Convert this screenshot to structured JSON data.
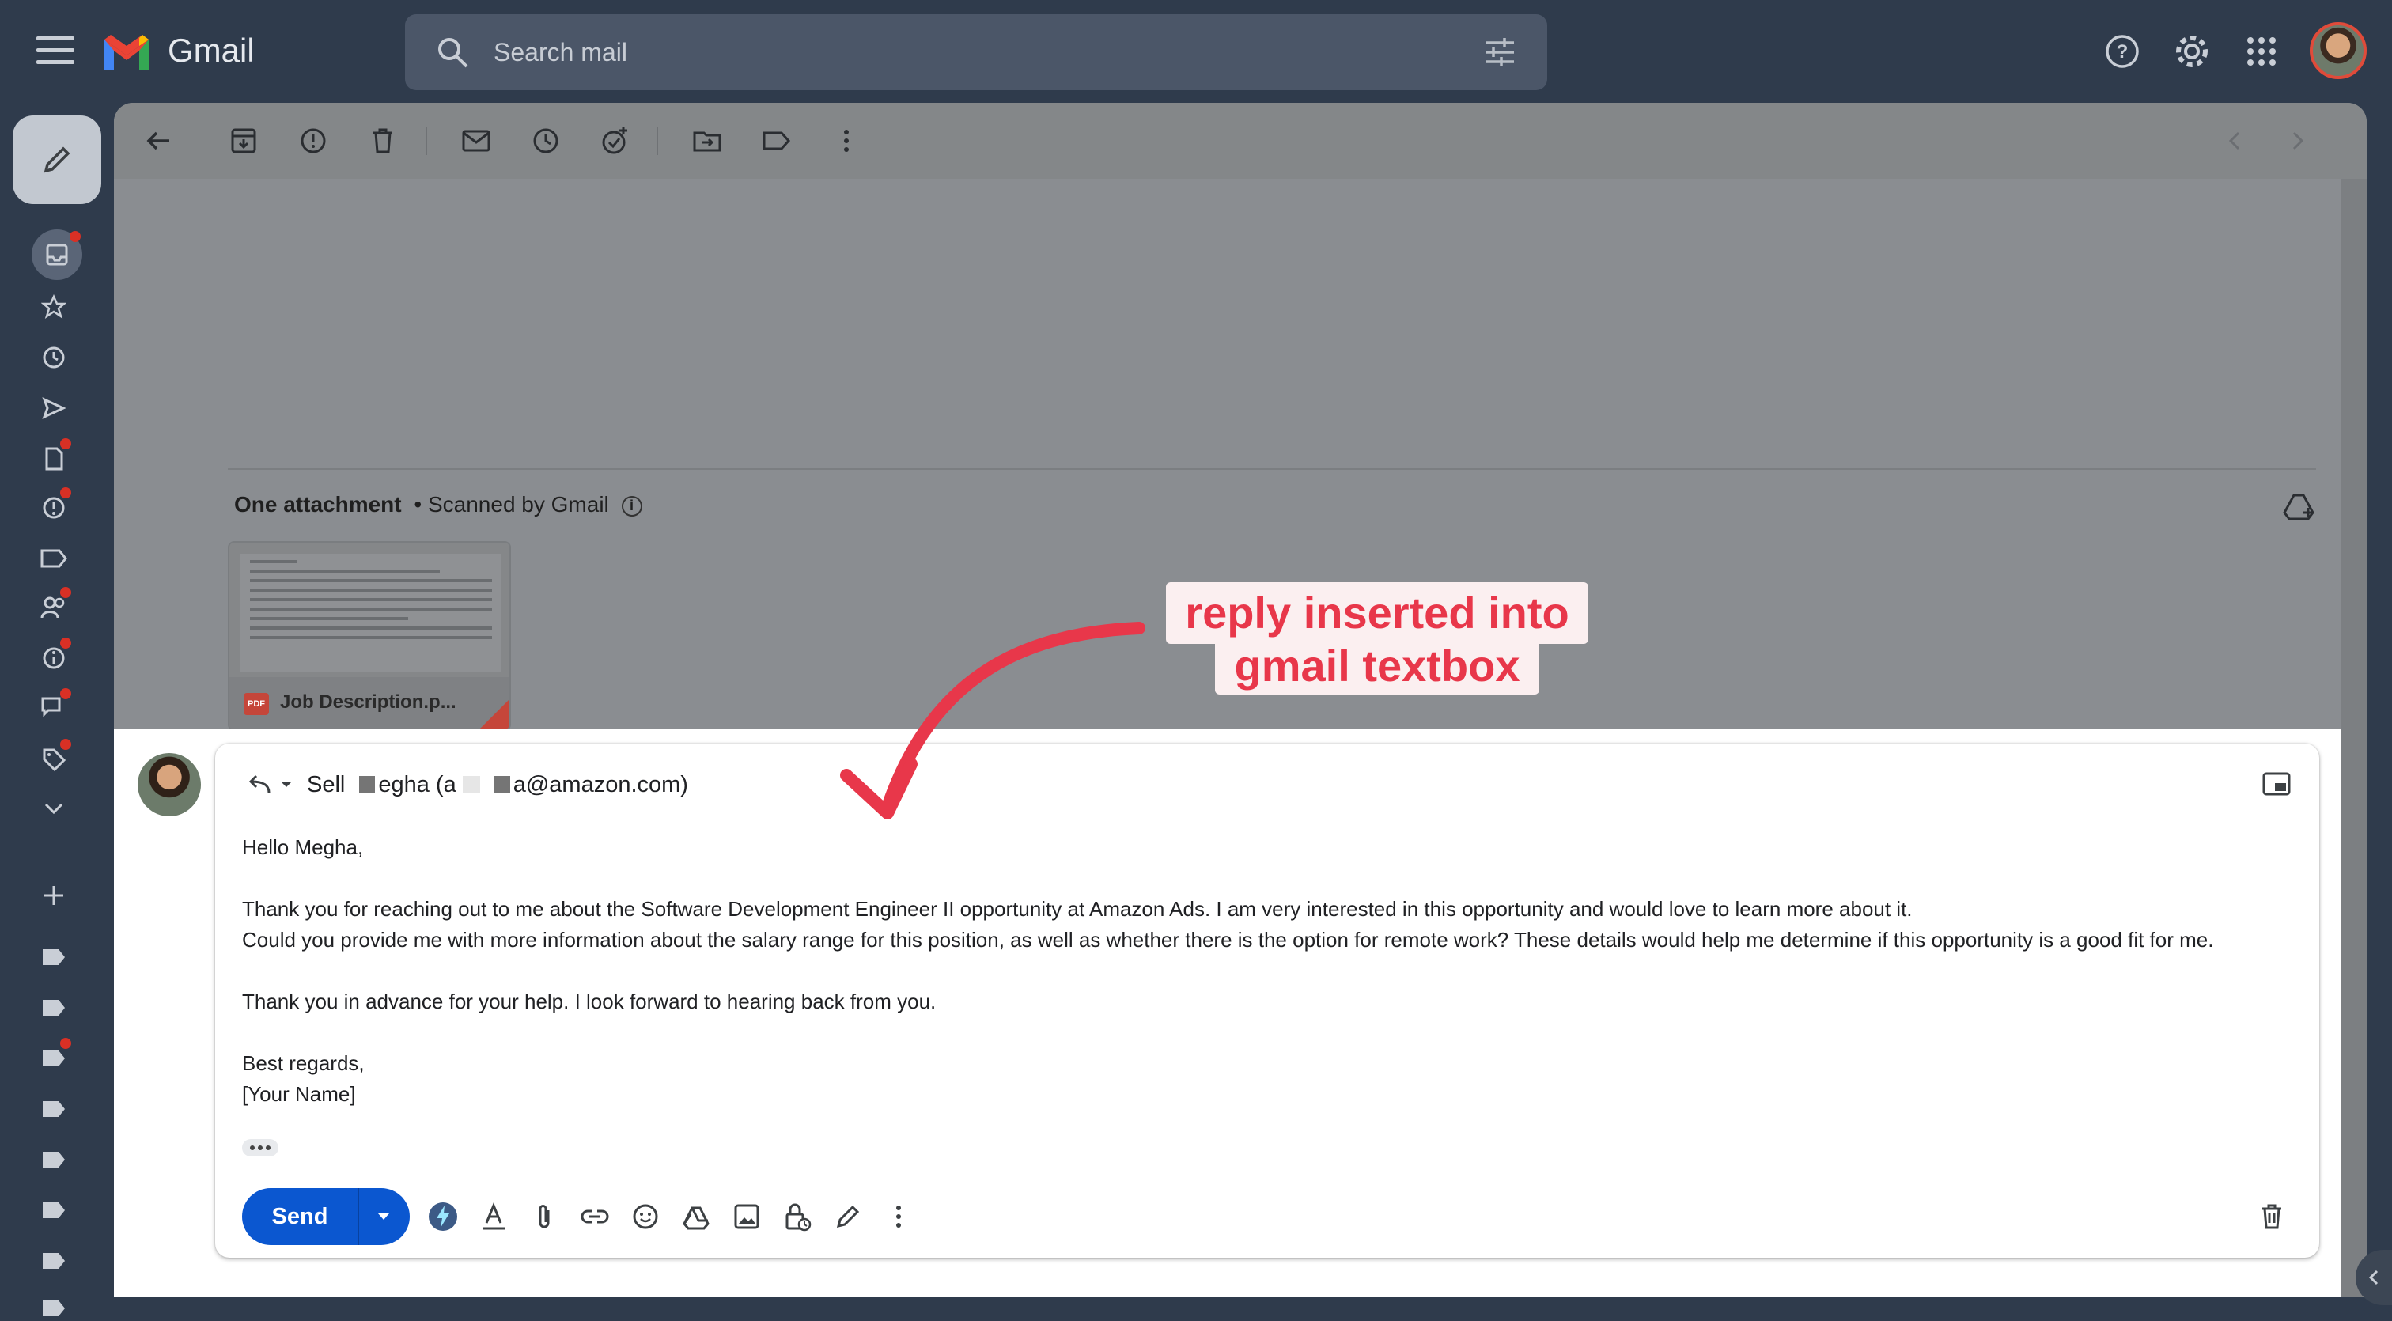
{
  "app": {
    "brand": "Gmail"
  },
  "search": {
    "placeholder": "Search mail"
  },
  "attachment": {
    "heading": "One attachment",
    "scanned": "• Scanned by Gmail",
    "file_name": "Job Description.p...",
    "file_type": "PDF"
  },
  "reply": {
    "from_name": "Sell",
    "to_partial": "egha (a",
    "to_email_end": "a@amazon.com)",
    "body": {
      "greeting": "Hello Megha,",
      "p1": "Thank you for reaching out to me about the Software Development Engineer II opportunity at Amazon Ads. I am very interested in this opportunity and would love to learn more about it.",
      "p2": "Could you provide me with more information about the salary range for this position, as well as whether there is the option for remote work? These details would help me determine if this opportunity is a good fit for me.",
      "p3": "Thank you in advance for your help. I look forward to hearing back from you.",
      "closing": "Best regards,",
      "signature": "[Your Name]"
    },
    "send_label": "Send"
  },
  "annotation": {
    "line1": "reply inserted into",
    "line2": "gmail textbox",
    "color": "#e8374a"
  },
  "colors": {
    "chrome_bg": "#2f3b4c",
    "send_blue": "#0b57d0",
    "dim_overlay": "#8a8d91"
  }
}
